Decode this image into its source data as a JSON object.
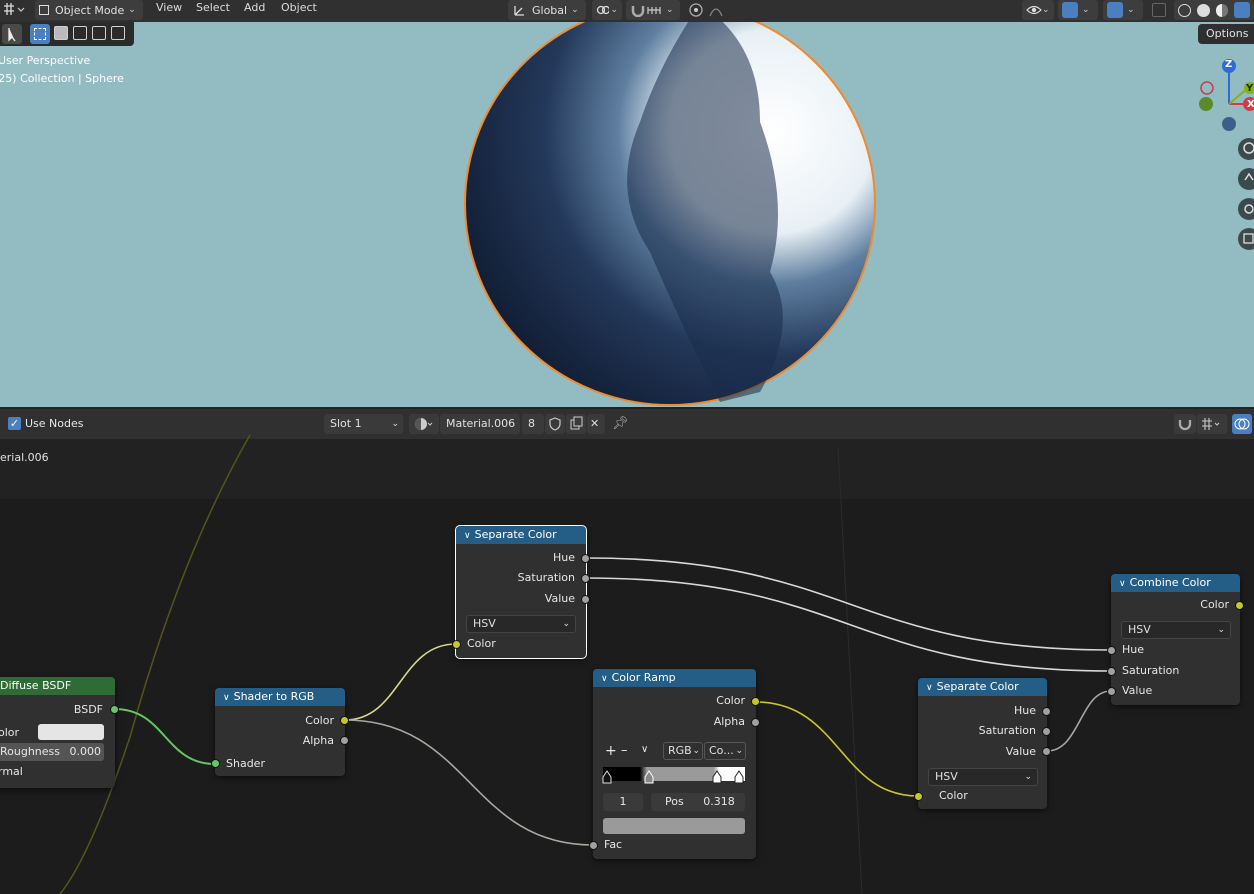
{
  "header": {
    "mode": "Object Mode",
    "menus": [
      "View",
      "Select",
      "Add",
      "Object"
    ],
    "transform_orientation": "Global",
    "options_label": "Options"
  },
  "viewport": {
    "perspective_label": "User Perspective",
    "collection_label": "(25) Collection | Sphere",
    "gizmo_axes": [
      "Z",
      "Y",
      "X"
    ],
    "background_color": "#93bbc2"
  },
  "node_editor": {
    "use_nodes_label": "Use Nodes",
    "slot": "Slot 1",
    "material_name": "Material.006",
    "user_count": "8",
    "breadcrumb": "erial.006"
  },
  "nodes": {
    "diffuse": {
      "title": "Diffuse BSDF",
      "output": "BSDF",
      "color_label": "olor",
      "roughness_label": "Roughness",
      "roughness_value": "0.000",
      "normal_label": "rmal"
    },
    "shader_to_rgb": {
      "title": "Shader to RGB",
      "out_color": "Color",
      "out_alpha": "Alpha",
      "in_shader": "Shader"
    },
    "separate_color_1": {
      "title": "Separate Color",
      "out_hue": "Hue",
      "out_saturation": "Saturation",
      "out_value": "Value",
      "mode": "HSV",
      "in_color": "Color"
    },
    "color_ramp": {
      "title": "Color Ramp",
      "out_color": "Color",
      "out_alpha": "Alpha",
      "add": "+",
      "remove": "–",
      "color_mode": "RGB",
      "interpolation": "Co...",
      "index": "1",
      "pos_label": "Pos",
      "pos_value": "0.318",
      "in_fac": "Fac"
    },
    "separate_color_2": {
      "title": "Separate Color",
      "out_hue": "Hue",
      "out_saturation": "Saturation",
      "out_value": "Value",
      "mode": "HSV",
      "in_color": "Color"
    },
    "combine_color": {
      "title": "Combine Color",
      "out_color": "Color",
      "mode": "HSV",
      "in_hue": "Hue",
      "in_saturation": "Saturation",
      "in_value": "Value"
    }
  },
  "colors": {
    "node_header_blue": "#245d85",
    "node_header_green": "#2f6b34",
    "socket_color": "#c7c729",
    "socket_float": "#a1a1a1",
    "socket_shader": "#63c763",
    "selection_orange": "#f08a2c"
  }
}
